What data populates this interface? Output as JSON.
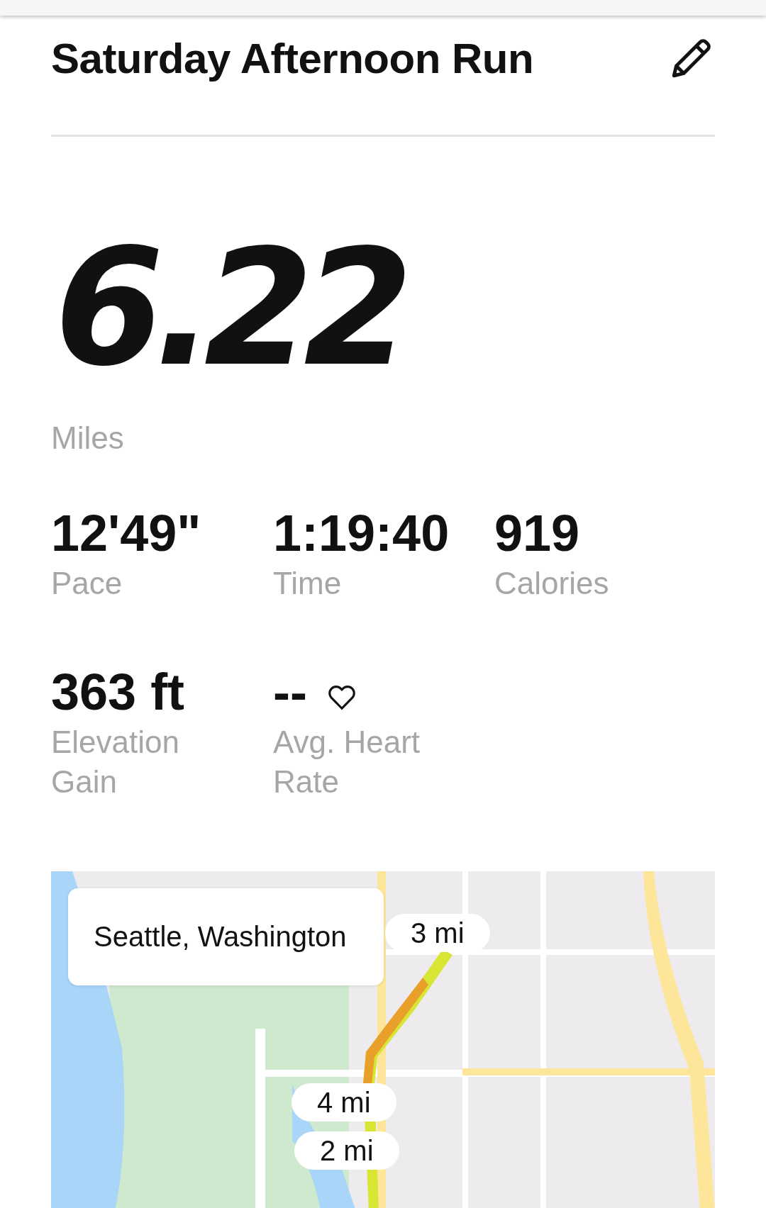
{
  "title": "Saturday Afternoon Run",
  "distance": {
    "value": "6.22",
    "unit": "Miles"
  },
  "stats": [
    {
      "kind": "plain",
      "value": "12'49\"",
      "label": "Pace"
    },
    {
      "kind": "plain",
      "value": "1:19:40",
      "label": "Time"
    },
    {
      "kind": "plain",
      "value": "919",
      "label": "Calories"
    },
    {
      "kind": "plain",
      "value": "363 ft",
      "label": "Elevation Gain"
    },
    {
      "kind": "heart",
      "value": "--",
      "label": "Avg. Heart Rate"
    }
  ],
  "map": {
    "kind": "picture",
    "location": "Seattle, Washington",
    "markers": [
      "3 mi",
      "4 mi",
      "2 mi"
    ]
  }
}
